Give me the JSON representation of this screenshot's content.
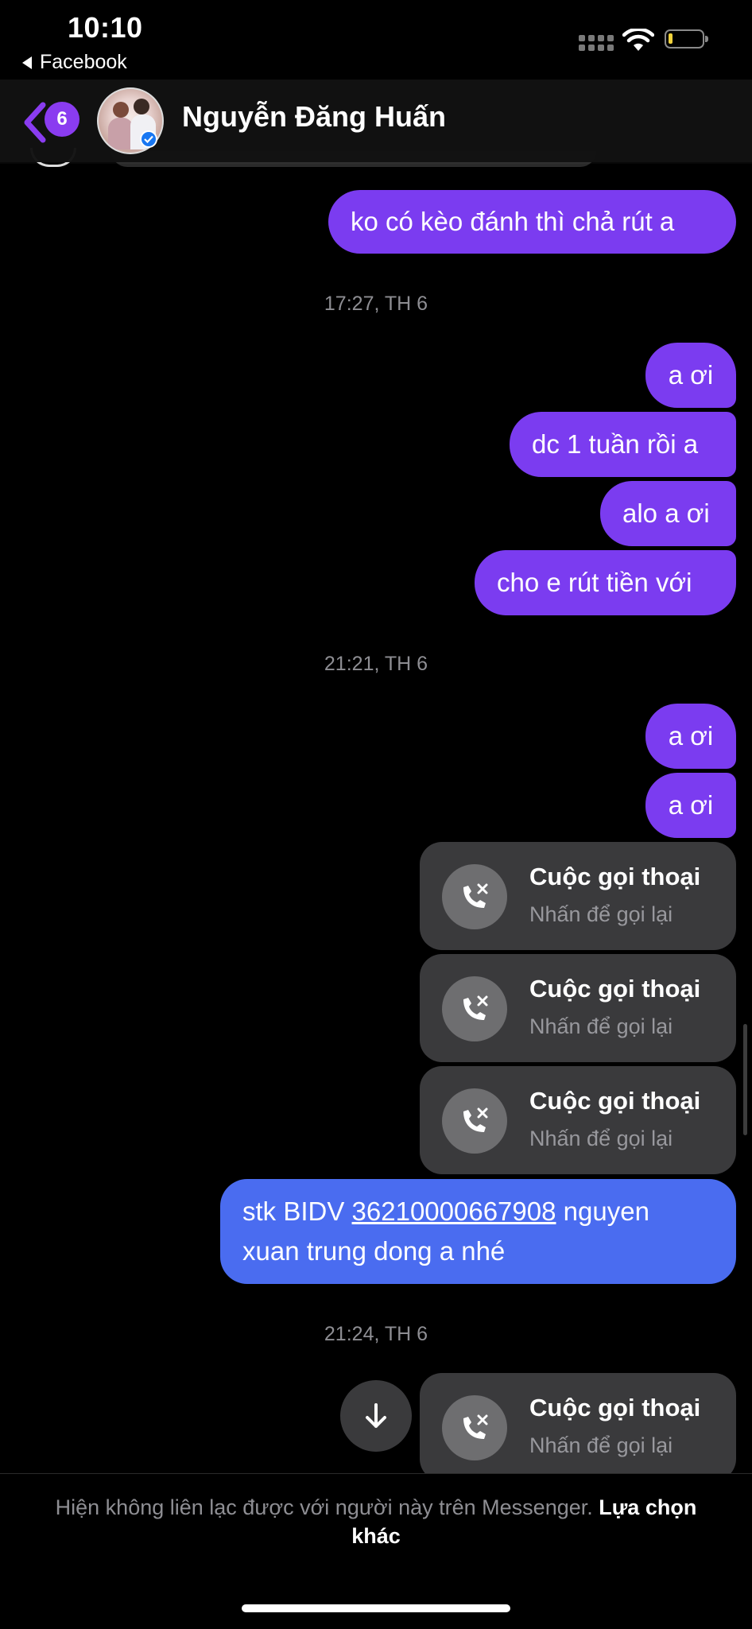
{
  "status_bar": {
    "time": "10:10",
    "back_app": "Facebook"
  },
  "header": {
    "unread_count": "6",
    "contact_name": "Nguyễn Đăng Huấn"
  },
  "messages": {
    "m1": "ko có kèo đánh thì chả rút a",
    "ts1": "17:27, TH 6",
    "m2": "a ơi",
    "m3": "dc 1 tuần rồi a",
    "m4": "alo a ơi",
    "m5": "cho e rút tiền với",
    "ts2": "21:21, TH 6",
    "m6": "a ơi",
    "m7": "a ơi",
    "call1": {
      "title": "Cuộc gọi thoại",
      "subtitle": "Nhấn để gọi lại"
    },
    "call2": {
      "title": "Cuộc gọi thoại",
      "subtitle": "Nhấn để gọi lại"
    },
    "call3": {
      "title": "Cuộc gọi thoại",
      "subtitle": "Nhấn để gọi lại"
    },
    "stk": {
      "prefix": "stk BIDV ",
      "account": "36210000667908",
      "suffix_line1": " nguyen",
      "line2": "xuan trung dong a nhé"
    },
    "ts3": "21:24, TH 6",
    "call4": {
      "title": "Cuộc gọi thoại",
      "subtitle": "Nhấn để gọi lại"
    }
  },
  "footer": {
    "notice": "Hiện không liên lạc được với người này trên Messenger. ",
    "option": "Lựa chọn khác"
  },
  "colors": {
    "bubble_purple": "#7b3cf0",
    "bubble_blue": "#4a6cf0",
    "call_bg": "#3a3a3c"
  }
}
